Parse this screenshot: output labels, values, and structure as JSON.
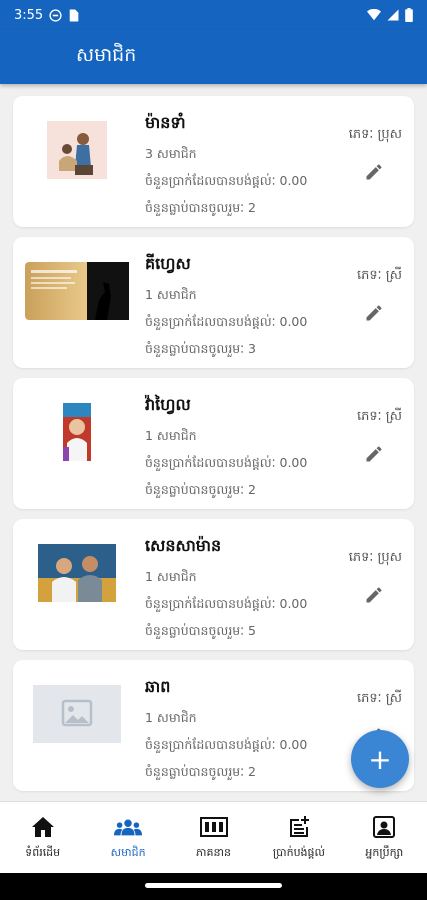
{
  "status_bar": {
    "time": "3:55"
  },
  "app_bar": {
    "title": "សមាជិក"
  },
  "members": [
    {
      "name": "ម៉ានទាំ",
      "count": "3 សមាជិក",
      "amount": "ចំនួនប្រាក់ដែលបានបង់ផ្តល់ៈ 0.00",
      "attendance": "ចំនួនធ្លាប់បានចូលរួមៈ 2",
      "gender": "ភេទៈ ប្រុស",
      "photo": "family-photo"
    },
    {
      "name": "គីហ្វេស",
      "count": "1 សមាជិក",
      "amount": "ចំនួនប្រាក់ដែលបានបង់ផ្តល់ៈ 0.00",
      "attendance": "ចំនួនធ្លាប់បានចូលរួមៈ 3",
      "gender": "ភេទៈ ស្រី",
      "photo": "quote-silhouette-photo"
    },
    {
      "name": "វ៉ាហ្វៃល",
      "count": "1 សមាជិក",
      "amount": "ចំនួនប្រាក់ដែលបានបង់ផ្តល់ៈ 0.00",
      "attendance": "ចំនួនធ្លាប់បានចូលរួមៈ 2",
      "gender": "ភេទៈ ស្រី",
      "photo": "portrait-photo"
    },
    {
      "name": "សេនសាម៉ាន",
      "count": "1 សមាជិក",
      "amount": "ចំនួនប្រាក់ដែលបានបង់ផ្តល់ៈ 0.00",
      "attendance": "ចំនួនធ្លាប់បានចូលរួមៈ 5",
      "gender": "ភេទៈ ប្រុស",
      "photo": "couple-photo"
    },
    {
      "name": "ឆាព",
      "count": "1 សមាជិក",
      "amount": "ចំនួនប្រាក់ដែលបានបង់ផ្តល់ៈ 0.00",
      "attendance": "ចំនួនធ្លាប់បានចូលរួមៈ 2",
      "gender": "ភេទៈ ស្រី",
      "photo": "placeholder-image-icon"
    }
  ],
  "fab": {
    "label": "+"
  },
  "bottom_nav": [
    {
      "label": "ទំព័រដើម",
      "icon": "home-icon",
      "active": false
    },
    {
      "label": "សមាជិក",
      "icon": "group-icon",
      "active": true
    },
    {
      "label": "ភាគនាន",
      "icon": "counter-icon",
      "active": false
    },
    {
      "label": "ប្រាក់បង់ផ្តល់",
      "icon": "post-add-icon",
      "active": false
    },
    {
      "label": "អ្នកប្រឹក្សា",
      "icon": "contact-icon",
      "active": false
    }
  ],
  "colors": {
    "primary": "#1565c0",
    "fab": "#3a86d4",
    "background": "#f0f0f0"
  }
}
